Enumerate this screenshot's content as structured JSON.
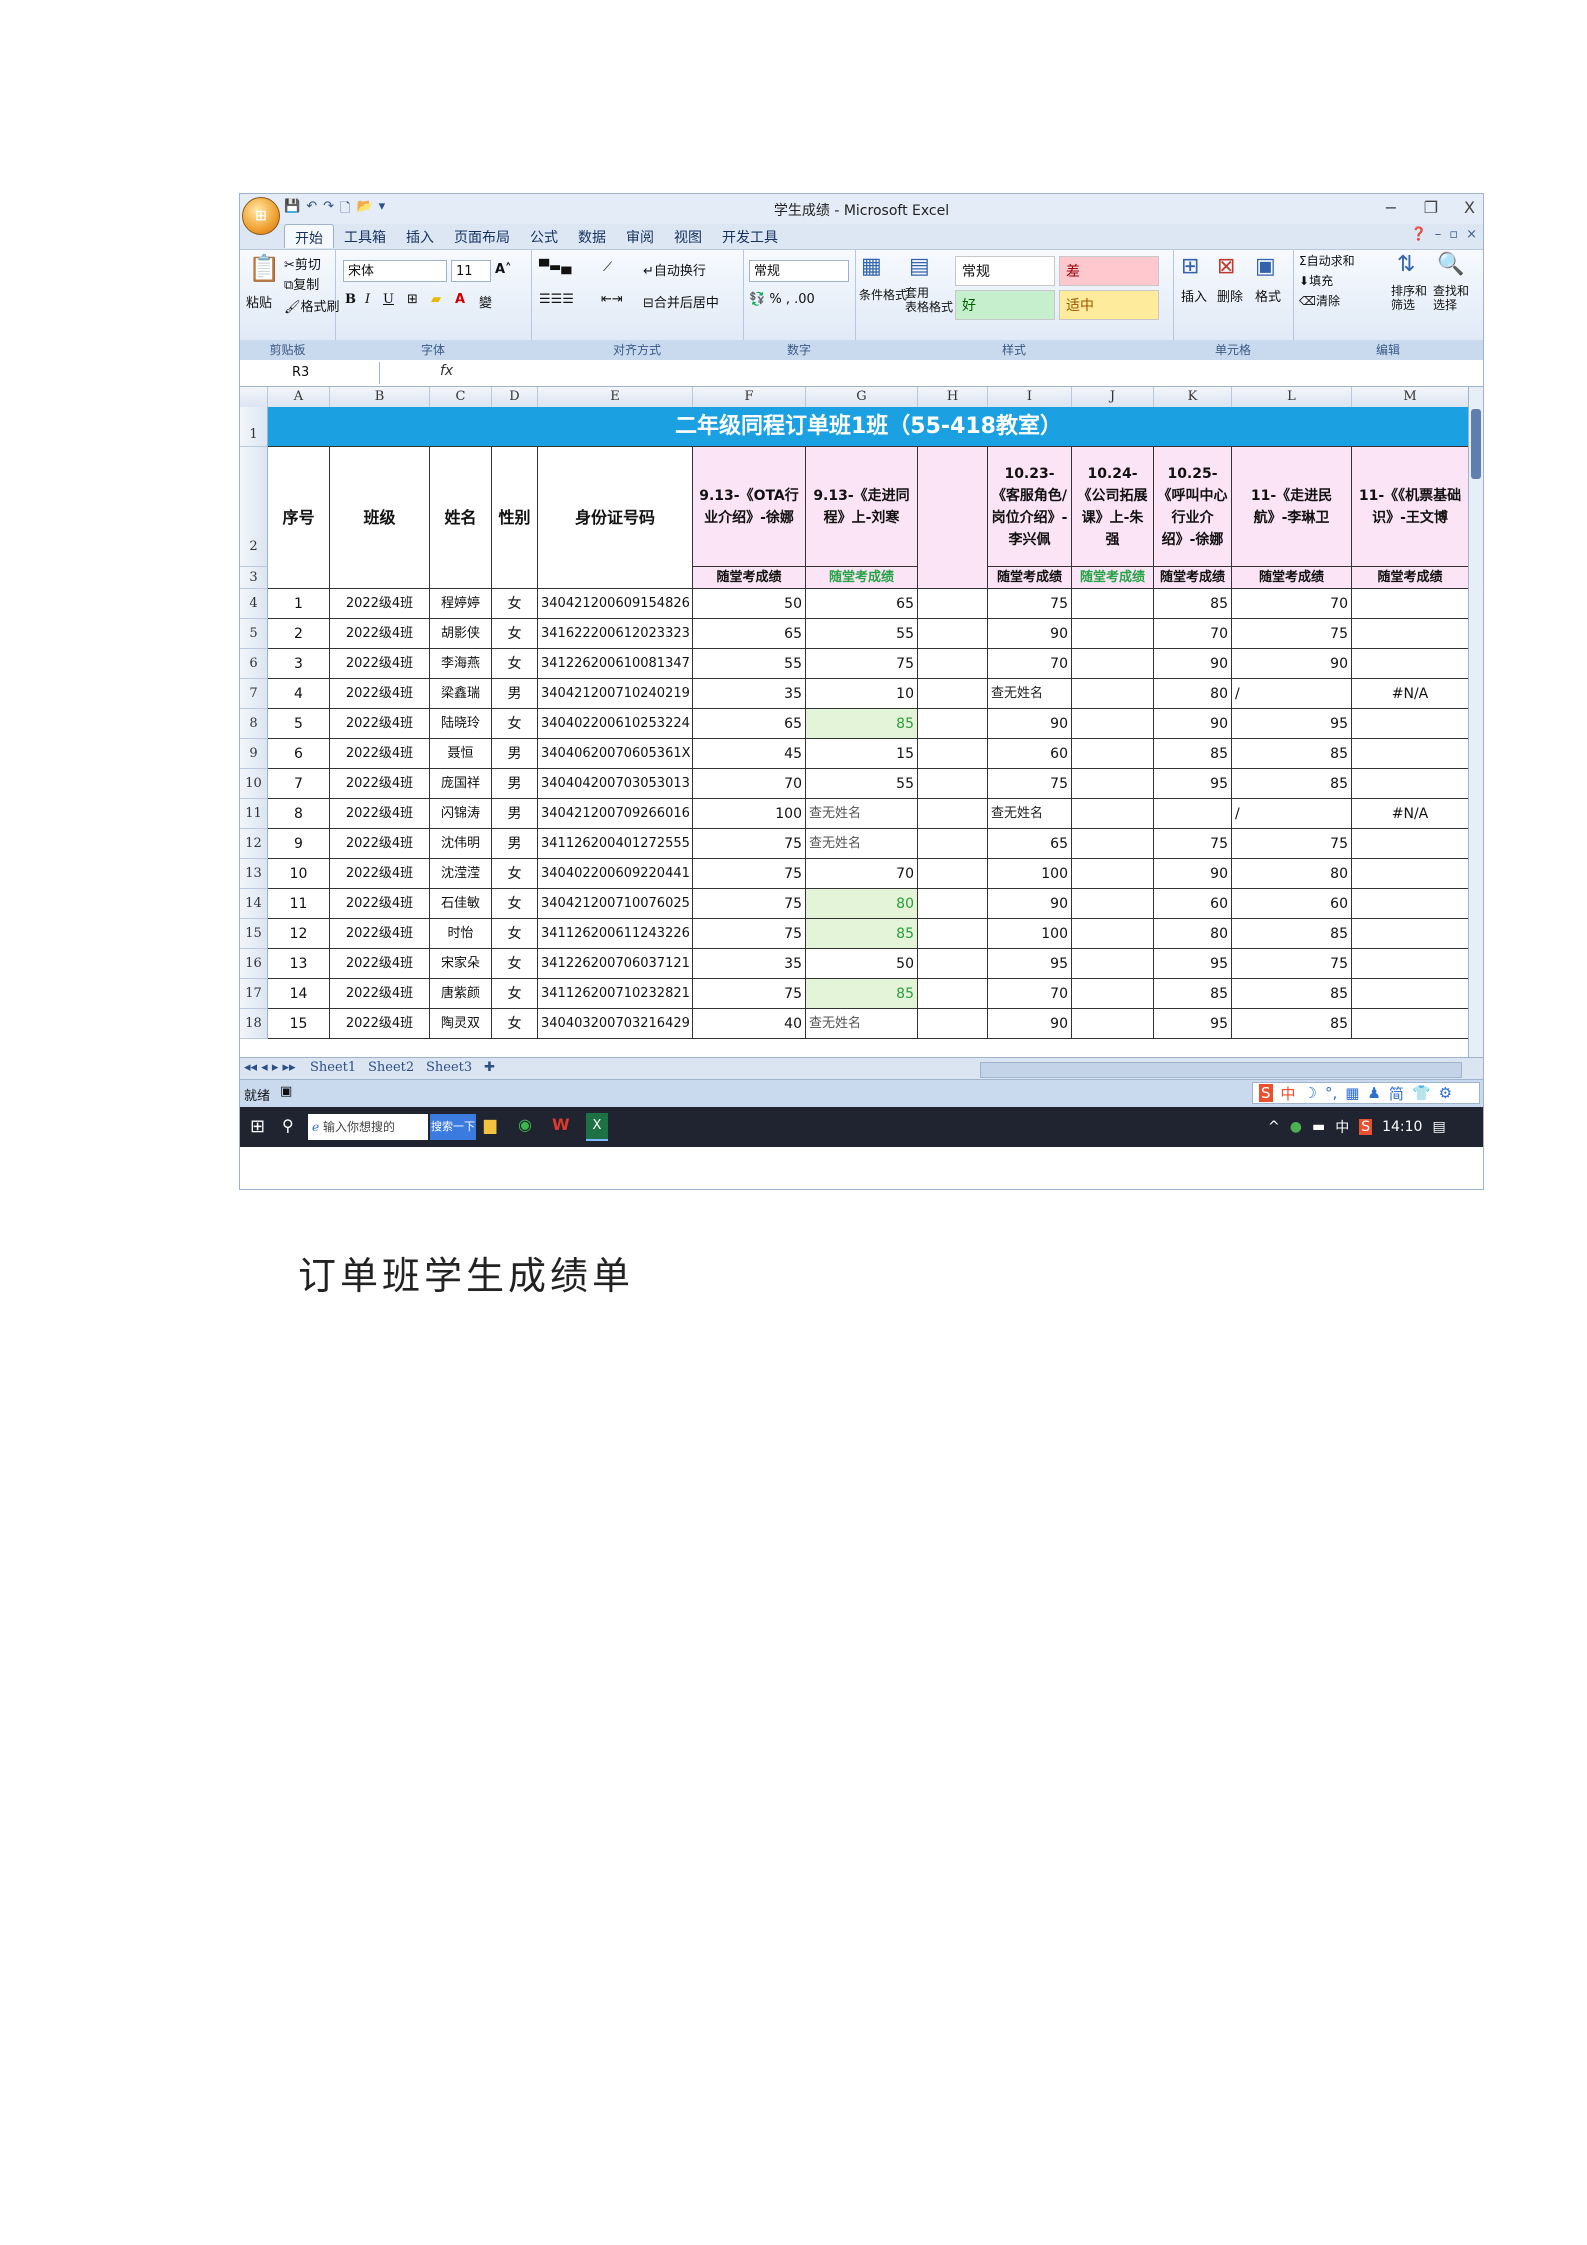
{
  "window": {
    "title": "学生成绩 - Microsoft Excel",
    "controls": [
      "−",
      "❐",
      "X"
    ]
  },
  "ribbon_tabs": [
    "开始",
    "工具箱",
    "插入",
    "页面布局",
    "公式",
    "数据",
    "审阅",
    "视图",
    "开发工具"
  ],
  "ribbon": {
    "clipboard": {
      "paste": "粘贴",
      "cut": "剪切",
      "copy": "复制",
      "format_painter": "格式刷",
      "label": "剪贴板"
    },
    "font": {
      "name": "宋体",
      "size": "11",
      "label": "字体"
    },
    "align": {
      "wrap": "自动换行",
      "merge": "合并后居中",
      "label": "对齐方式"
    },
    "number": {
      "format": "常规",
      "label": "数字"
    },
    "styles": {
      "cond": "条件格式",
      "table": "套用\n表格格式",
      "normal": "常规",
      "bad": "差",
      "good": "好",
      "neutral": "适中",
      "label": "样式"
    },
    "cells": {
      "insert": "插入",
      "delete": "删除",
      "format": "格式",
      "label": "单元格"
    },
    "editing": {
      "autosum": "自动求和",
      "fill": "填充",
      "clear": "清除",
      "sort": "排序和\n筛选",
      "find": "查找和\n选择",
      "label": "编辑"
    }
  },
  "formula_bar": {
    "name_box": "R3",
    "fx": "fx"
  },
  "columns": [
    "A",
    "B",
    "C",
    "D",
    "E",
    "F",
    "G",
    "H",
    "I",
    "J",
    "K",
    "L",
    "M"
  ],
  "sheet": {
    "title": "二年级同程订单班1班（55-418教室）",
    "headers": {
      "seq": "序号",
      "class": "班级",
      "name": "姓名",
      "gender": "性别",
      "id": "身份证号码",
      "f": "9.13-《OTA行业介绍》-徐娜",
      "g": "9.13-《走进同程》上-刘寒",
      "i": "10.23-《客服角色/岗位介绍》-李兴佩",
      "j": "10.24-《公司拓展课》上-朱强",
      "k": "10.25-《呼叫中心行业介绍》-徐娜",
      "l": "11-《走进民航》-李琳卫",
      "m": "11-《《机票基础识》-王文博"
    },
    "sub_label": "随堂考成绩",
    "rows": [
      {
        "r": "4",
        "seq": "1",
        "class": "2022级4班",
        "name": "程婷婷",
        "gender": "女",
        "id": "340421200609154826",
        "f": "50",
        "g": "65",
        "i": "75",
        "k": "85",
        "l": "70",
        "m": ""
      },
      {
        "r": "5",
        "seq": "2",
        "class": "2022级4班",
        "name": "胡影侠",
        "gender": "女",
        "id": "341622200612023323",
        "f": "65",
        "g": "55",
        "i": "90",
        "k": "70",
        "l": "75",
        "m": ""
      },
      {
        "r": "6",
        "seq": "3",
        "class": "2022级4班",
        "name": "李海燕",
        "gender": "女",
        "id": "341226200610081347",
        "f": "55",
        "g": "75",
        "i": "70",
        "k": "90",
        "l": "90",
        "m": ""
      },
      {
        "r": "7",
        "seq": "4",
        "class": "2022级4班",
        "name": "梁鑫瑞",
        "gender": "男",
        "id": "340421200710240219",
        "f": "35",
        "g": "10",
        "i": "查无姓名",
        "k": "80",
        "l": "/",
        "m": "#N/A"
      },
      {
        "r": "8",
        "seq": "5",
        "class": "2022级4班",
        "name": "陆晓玲",
        "gender": "女",
        "id": "340402200610253224",
        "f": "65",
        "g": "85",
        "i": "90",
        "k": "90",
        "l": "95",
        "m": ""
      },
      {
        "r": "9",
        "seq": "6",
        "class": "2022级4班",
        "name": "聂恒",
        "gender": "男",
        "id": "34040620070605361X",
        "f": "45",
        "g": "15",
        "i": "60",
        "k": "85",
        "l": "85",
        "m": ""
      },
      {
        "r": "10",
        "seq": "7",
        "class": "2022级4班",
        "name": "庞国祥",
        "gender": "男",
        "id": "340404200703053013",
        "f": "70",
        "g": "55",
        "i": "75",
        "k": "95",
        "l": "85",
        "m": ""
      },
      {
        "r": "11",
        "seq": "8",
        "class": "2022级4班",
        "name": "闪锦涛",
        "gender": "男",
        "id": "340421200709266016",
        "f": "100",
        "g": "查无姓名",
        "i": "查无姓名",
        "k": "",
        "l": "/",
        "m": "#N/A"
      },
      {
        "r": "12",
        "seq": "9",
        "class": "2022级4班",
        "name": "沈伟明",
        "gender": "男",
        "id": "341126200401272555",
        "f": "75",
        "g": "查无姓名",
        "i": "65",
        "k": "75",
        "l": "75",
        "m": ""
      },
      {
        "r": "13",
        "seq": "10",
        "class": "2022级4班",
        "name": "沈滢滢",
        "gender": "女",
        "id": "340402200609220441",
        "f": "75",
        "g": "70",
        "i": "100",
        "k": "90",
        "l": "80",
        "m": ""
      },
      {
        "r": "14",
        "seq": "11",
        "class": "2022级4班",
        "name": "石佳敏",
        "gender": "女",
        "id": "340421200710076025",
        "f": "75",
        "g": "80",
        "i": "90",
        "k": "60",
        "l": "60",
        "m": ""
      },
      {
        "r": "15",
        "seq": "12",
        "class": "2022级4班",
        "name": "时怡",
        "gender": "女",
        "id": "341126200611243226",
        "f": "75",
        "g": "85",
        "i": "100",
        "k": "80",
        "l": "85",
        "m": ""
      },
      {
        "r": "16",
        "seq": "13",
        "class": "2022级4班",
        "name": "宋家朵",
        "gender": "女",
        "id": "341226200706037121",
        "f": "35",
        "g": "50",
        "i": "95",
        "k": "95",
        "l": "75",
        "m": ""
      },
      {
        "r": "17",
        "seq": "14",
        "class": "2022级4班",
        "name": "唐紫颜",
        "gender": "女",
        "id": "341126200710232821",
        "f": "75",
        "g": "85",
        "i": "70",
        "k": "85",
        "l": "85",
        "m": ""
      },
      {
        "r": "18",
        "seq": "15",
        "class": "2022级4班",
        "name": "陶灵双",
        "gender": "女",
        "id": "340403200703216429",
        "f": "40",
        "g": "查无姓名",
        "i": "90",
        "k": "95",
        "l": "85",
        "m": ""
      }
    ]
  },
  "sheet_tabs": [
    "Sheet1",
    "Sheet2",
    "Sheet3"
  ],
  "status": {
    "ready": "就绪"
  },
  "ime_bar": [
    "中",
    "简"
  ],
  "taskbar": {
    "search": "输入你想搜的",
    "search_btn": "搜索一下",
    "tray_lang": "中",
    "time": "14:10"
  },
  "caption": "订单班学生成绩单"
}
